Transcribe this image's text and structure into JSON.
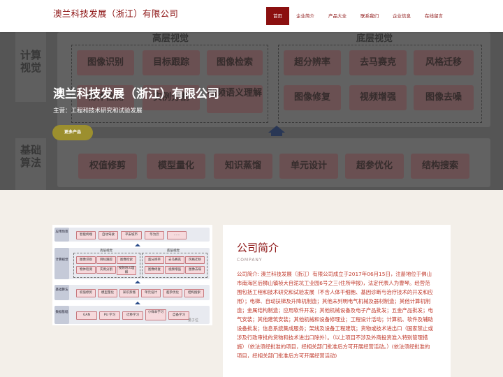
{
  "header": {
    "brand": "澳兰科技发展（浙江）有限公司",
    "nav": [
      "首页",
      "企业简介",
      "产品大全",
      "联系我们",
      "企业信息",
      "在线留言"
    ],
    "active_index": 0
  },
  "hero": {
    "title": "澳兰科技发展（浙江）有限公司",
    "subtitle": "主营：工程和技术研究和试验发展",
    "button": "更多产品",
    "diagram": {
      "side_top": "计算视觉",
      "side_bottom": "基础算法",
      "group_left": "高层视觉",
      "group_right": "底层视觉",
      "left_boxes": [
        "图像识别",
        "目标跟踪",
        "图像检索",
        "物体检测",
        "实例分割",
        "视频语义理解"
      ],
      "right_boxes": [
        "超分辨率",
        "去马赛克",
        "风格迁移",
        "图像修复",
        "视频增强",
        "图像去噪"
      ],
      "bottom_boxes": [
        "权值修剪",
        "模型量化",
        "知识蒸馏",
        "单元设计",
        "超参优化",
        "结构搜索"
      ]
    }
  },
  "mini_diagram": {
    "rows": [
      {
        "side": "应用场景",
        "items": [
          "智能终端",
          "自动驾驶",
          "平安城市",
          "华为云",
          "……"
        ]
      },
      {
        "side": "计算视觉",
        "group_left": "高层视觉",
        "group_right": "底层视觉",
        "left_items": [
          "图像识别",
          "目标跟踪",
          "图像检索",
          "物体检测",
          "实例分割",
          "视频语义理解"
        ],
        "right_items": [
          "超分辨率",
          "去马赛克",
          "风格迁移",
          "图像修复",
          "视频增强",
          "图像去噪"
        ]
      },
      {
        "side": "基础算法",
        "items": [
          "权值修剪",
          "模型量化",
          "知识蒸馏",
          "单元设计",
          "超参优化",
          "结构搜索"
        ]
      },
      {
        "side": "数据基础",
        "items": [
          "GAN",
          "PU 学习",
          "迁移学习",
          "小样本学习",
          "自备学习"
        ]
      }
    ],
    "watermark": "量子位"
  },
  "intro": {
    "title": "公司简介",
    "subtitle_en": "COMPANY",
    "body": "公司简介: 澳兰科技发展（浙江）有限公司成立于2017年06月15日，注册地位于佛山市南海区后狮山镇祯大自泥坑工业园6号之三(住所申报)，法定代表人为曹琴。经营范围包括工程和技术研究和试验发展（不含人体干细胞、基因诊断与治疗技术的开发和应用）；电梯、自动扶梯及升降机制造；其他未列明电气机械及器材制造；其他计算机制造；金属结构制造；应用软件开发；其他机械设备及电子产品批发；五金产品批发；电气安装；其他建筑安装；其他机械和设备修理业；工程设计活动；计算机、软件及辅助设备批发；信息系统集成服务；架线及设备工程建筑；货物或技术进出口（国家禁止或涉及行政审批的货物和技术进出口除外）。（以上项目不涉及外商投资准入特别管理措施）（依法须经批准的项目，经相关部门批准后方可开展经营活动。）(依法须经批准的项目，经相关部门批准后方可开展经营活动)"
  }
}
